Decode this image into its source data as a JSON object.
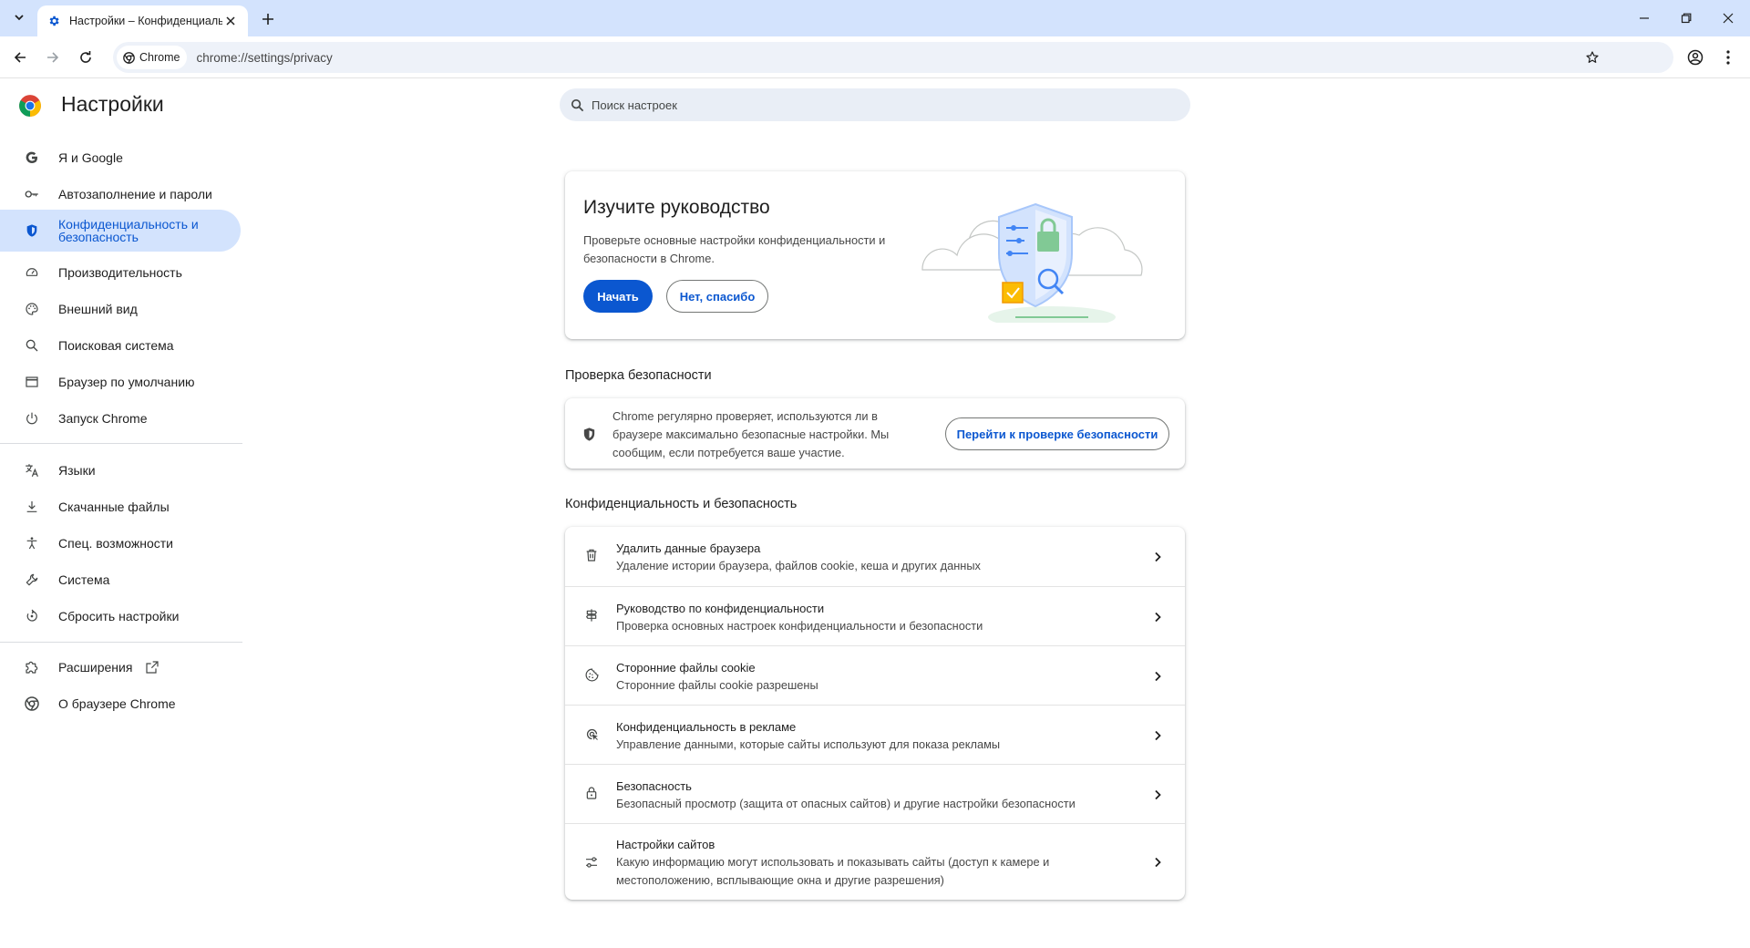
{
  "browser": {
    "tab_title": "Настройки – Конфиденциальность и безопасность",
    "chip_label": "Chrome",
    "url": "chrome://settings/privacy"
  },
  "settings": {
    "title": "Настройки",
    "search_placeholder": "Поиск настроек"
  },
  "sidebar": {
    "items": [
      {
        "label": "Я и Google",
        "icon": "google-icon"
      },
      {
        "label": "Автозаполнение и пароли",
        "icon": "key-icon"
      },
      {
        "label": "Конфиденциальность и безопасность",
        "icon": "shield-icon",
        "active": true
      },
      {
        "label": "Производительность",
        "icon": "speedometer-icon"
      },
      {
        "label": "Внешний вид",
        "icon": "palette-icon"
      },
      {
        "label": "Поисковая система",
        "icon": "search-icon"
      },
      {
        "label": "Браузер по умолчанию",
        "icon": "browser-window-icon"
      },
      {
        "label": "Запуск Chrome",
        "icon": "power-icon"
      },
      {
        "label": "Языки",
        "icon": "translate-icon"
      },
      {
        "label": "Скачанные файлы",
        "icon": "download-icon"
      },
      {
        "label": "Спец. возможности",
        "icon": "accessibility-icon"
      },
      {
        "label": "Система",
        "icon": "wrench-icon"
      },
      {
        "label": "Сбросить настройки",
        "icon": "reset-icon"
      },
      {
        "label": "Расширения",
        "icon": "puzzle-icon"
      },
      {
        "label": "О браузере Chrome",
        "icon": "chrome-icon"
      }
    ]
  },
  "guide": {
    "title": "Изучите руководство",
    "description": "Проверьте основные настройки конфиденциальности и безопасности в Chrome.",
    "start_label": "Начать",
    "dismiss_label": "Нет, спасибо"
  },
  "safety_check": {
    "heading": "Проверка безопасности",
    "text": "Chrome регулярно проверяет, используются ли в браузере максимально безопасные настройки. Мы сообщим, если потребуется ваше участие.",
    "button_label": "Перейти к проверке безопасности"
  },
  "privacy": {
    "heading": "Конфиденциальность и безопасность",
    "rows": [
      {
        "title": "Удалить данные браузера",
        "subtitle": "Удаление истории браузера, файлов cookie, кеша и других данных",
        "icon": "trash-icon"
      },
      {
        "title": "Руководство по конфиденциальности",
        "subtitle": "Проверка основных настроек конфиденциальности и безопасности",
        "icon": "signpost-icon"
      },
      {
        "title": "Сторонние файлы cookie",
        "subtitle": "Сторонние файлы cookie разрешены",
        "icon": "cookie-icon"
      },
      {
        "title": "Конфиденциальность в рекламе",
        "subtitle": "Управление данными, которые сайты используют для показа рекламы",
        "icon": "ad-privacy-icon"
      },
      {
        "title": "Безопасность",
        "subtitle": "Безопасный просмотр (защита от опасных сайтов) и другие настройки безопасности",
        "icon": "lock-icon"
      },
      {
        "title": "Настройки сайтов",
        "subtitle": "Какую информацию могут использовать и показывать сайты (доступ к камере и местоположению, всплывающие окна и другие разрешения)",
        "icon": "tune-icon"
      }
    ]
  },
  "colors": {
    "accent": "#0b57d0",
    "active_nav_bg": "#d3e3fd",
    "titlebar": "#d3e3fd"
  }
}
